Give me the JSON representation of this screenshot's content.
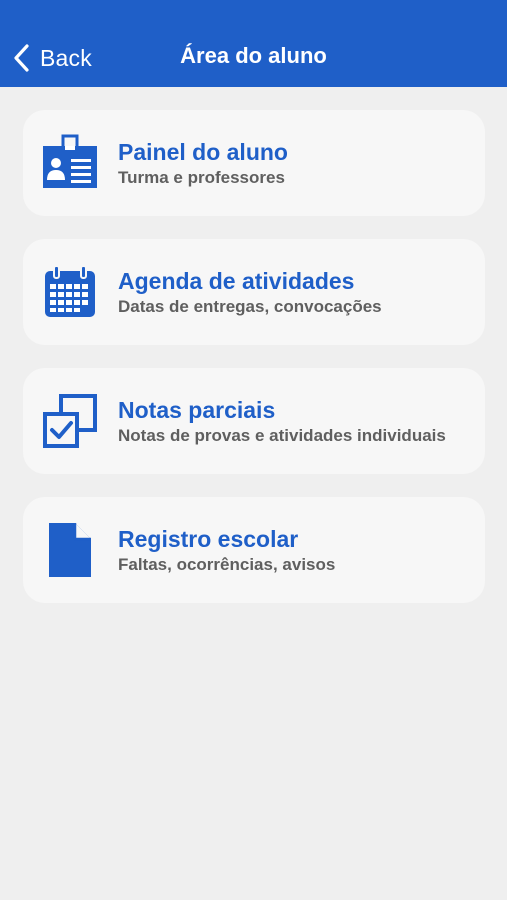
{
  "nav": {
    "back_label": "Back",
    "title": "Área do aluno"
  },
  "menu": {
    "items": [
      {
        "icon": "student-id-badge-icon",
        "title": "Painel do aluno",
        "subtitle": "Turma e professores"
      },
      {
        "icon": "calendar-icon",
        "title": "Agenda de atividades",
        "subtitle": "Datas de entregas, convocações"
      },
      {
        "icon": "grades-checkbox-icon",
        "title": "Notas parciais",
        "subtitle": "Notas de provas e atividades individuais"
      },
      {
        "icon": "document-icon",
        "title": "Registro escolar",
        "subtitle": "Faltas, ocorrências, avisos"
      }
    ]
  },
  "colors": {
    "primary": "#1f5fc8",
    "background": "#efefef",
    "card": "#f7f7f7",
    "subtitle": "#5f5f5f"
  }
}
